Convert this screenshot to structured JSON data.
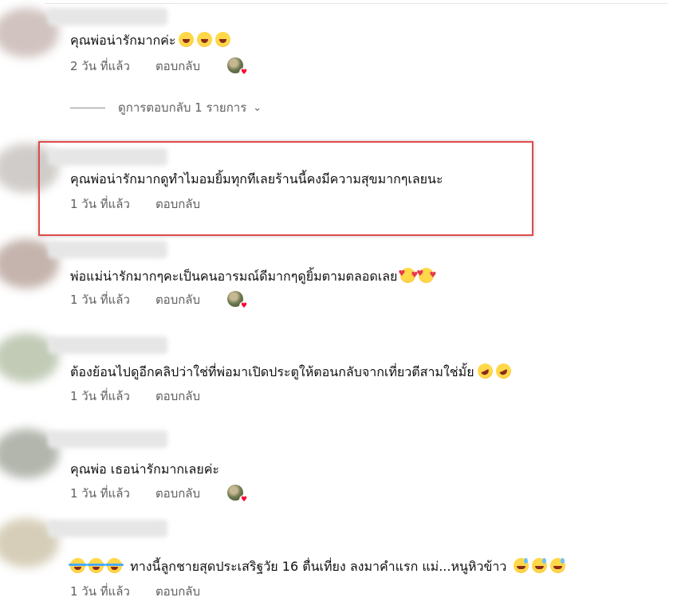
{
  "comments": [
    {
      "text": "คุณพ่อน่ารักมากค่ะ",
      "emojis": [
        "laugh",
        "laugh",
        "laugh"
      ],
      "time": "2 วัน ที่แล้ว",
      "reply_label": "ตอบกลับ",
      "creator_heart": true
    },
    {
      "text": "คุณพ่อน่ารักมากดูทำไมอมยิ้มทุกทีเลยร้านนี้คงมีความสุขมากๆเลยนะ",
      "emojis": [],
      "time": "1 วัน ที่แล้ว",
      "reply_label": "ตอบกลับ",
      "creator_heart": false,
      "highlighted": true
    },
    {
      "text": "พ่อแม่น่ารักมากๆคะเป็นคนอารมณ์ดีมากๆดูยิ้มตามตลอดเลย",
      "emojis": [
        "heart-face",
        "heart-face"
      ],
      "time": "1 วัน ที่แล้ว",
      "reply_label": "ตอบกลับ",
      "creator_heart": true
    },
    {
      "text": "ต้องย้อนไปดูอีกคลิปว่าใช่ที่พ่อมาเปิดประตูให้ตอนกลับจากเที่ยวตีสามใช่มั้ย",
      "emojis": [
        "rofl",
        "rofl"
      ],
      "time": "1 วัน ที่แล้ว",
      "reply_label": "ตอบกลับ",
      "creator_heart": false
    },
    {
      "text": "คุณพ่อ เธอน่ารักมากเลยค่ะ",
      "emojis": [],
      "time": "1 วัน ที่แล้ว",
      "reply_label": "ตอบกลับ",
      "creator_heart": true
    },
    {
      "text": "ทางนี้ลูกชายสุดประเสริฐวัย 16 ตื่นเที่ยง ลงมาคำแรก แม่...หนูหิวข้าว",
      "emojis_before": [
        "joy",
        "joy",
        "joy"
      ],
      "emojis": [
        "grin-sweat",
        "grin-sweat",
        "grin-sweat"
      ],
      "time": "1 วัน ที่แล้ว",
      "reply_label": "ตอบกลับ",
      "creator_heart": false
    }
  ],
  "view_replies": {
    "label": "ดูการตอบกลับ 1 รายการ",
    "chevron_icon": "chevron-down-icon"
  },
  "colors": {
    "highlight_border": "#e04b4b",
    "secondary_text": "#606060",
    "heart": "#ff0033"
  }
}
